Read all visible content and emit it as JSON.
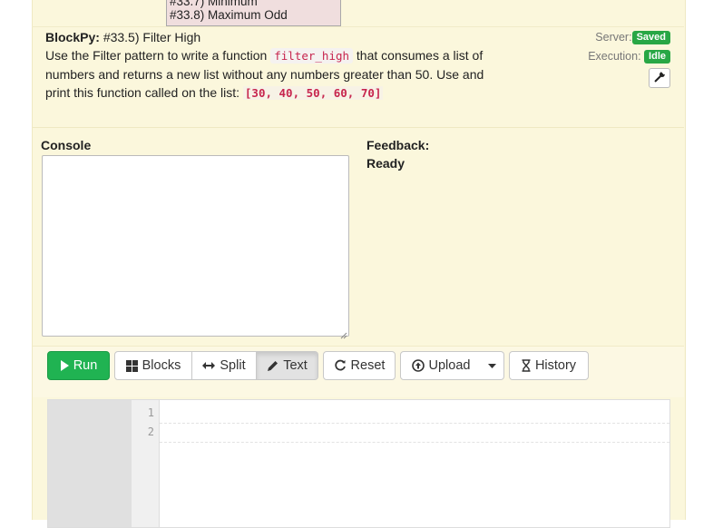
{
  "problem_dropdown": {
    "items": [
      "#33.7) Minimum",
      "#33.8) Maximum Odd"
    ]
  },
  "problem": {
    "app": "BlockPy:",
    "title": "#33.5) Filter High",
    "desc_1": "Use the Filter pattern to write a function",
    "function_name": "filter_high",
    "desc_2": "that consumes a list of numbers and returns a new list without any numbers greater than 50. Use and print this function called on the list:",
    "list_literal": "[30, 40, 50, 60, 70]"
  },
  "status": {
    "server_label": "Server:",
    "server_value": "Saved",
    "execution_label": "Execution:",
    "execution_value": "Idle",
    "badge_color": "#28a745"
  },
  "console": {
    "label": "Console",
    "value": ""
  },
  "feedback": {
    "label": "Feedback:",
    "message": "Ready"
  },
  "toolbar": {
    "run": "Run",
    "blocks": "Blocks",
    "split": "Split",
    "text": "Text",
    "reset": "Reset",
    "upload": "Upload",
    "history": "History",
    "run_color": "#20b352",
    "active_mode": "Text"
  },
  "editor": {
    "line_numbers": [
      "1",
      "2"
    ]
  }
}
